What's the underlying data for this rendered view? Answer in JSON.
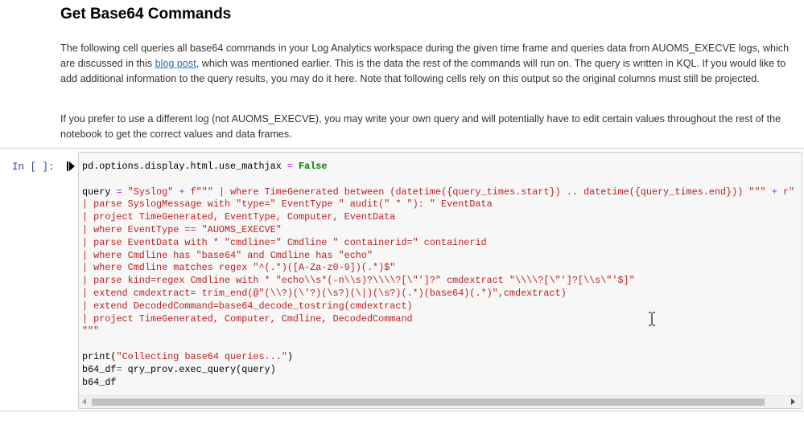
{
  "markdown": {
    "heading": "Get Base64 Commands",
    "p1_a": "The following cell queries all base64 commands in your Log Analytics workspace during the given time frame and queries data from AUOMS_EXECVE logs, which are discussed in this ",
    "p1_link": "blog post",
    "p1_b": ", which was mentioned earlier. This is the data the rest of the commands will run on. The query is written in KQL. If you would like to add additional information to the query results, you may do it here. Note that following cells rely on this output so the original columns must still be projected.",
    "p2": "If you prefer to use a different log (not AUOMS_EXECVE), you may write your own query and will potentially have to edit certain values throughout the rest of the notebook to get the correct values and data frames."
  },
  "cell": {
    "prompt": "In [ ]:",
    "lines": [
      [
        {
          "t": "pd.options.display.html.use_mathjax ",
          "c": ""
        },
        {
          "t": "=",
          "c": "op"
        },
        {
          "t": " ",
          "c": ""
        },
        {
          "t": "False",
          "c": "kw"
        }
      ],
      [],
      [
        {
          "t": "query ",
          "c": ""
        },
        {
          "t": "=",
          "c": "op"
        },
        {
          "t": " ",
          "c": ""
        },
        {
          "t": "\"Syslog\"",
          "c": "str"
        },
        {
          "t": " ",
          "c": ""
        },
        {
          "t": "+",
          "c": "op"
        },
        {
          "t": " ",
          "c": ""
        },
        {
          "t": "f\"\"\" | where TimeGenerated between (datetime({query_times.start}) .. datetime({query_times.end})) \"\"\"",
          "c": "str"
        },
        {
          "t": " ",
          "c": ""
        },
        {
          "t": "+",
          "c": "op"
        },
        {
          "t": " ",
          "c": ""
        },
        {
          "t": "r\"",
          "c": "str"
        }
      ],
      [
        {
          "t": "| parse SyslogMessage with \"type=\" EventType \" audit(\" * \"): \" EventData",
          "c": "str"
        }
      ],
      [
        {
          "t": "| project TimeGenerated, EventType, Computer, EventData",
          "c": "str"
        }
      ],
      [
        {
          "t": "| where EventType == \"AUOMS_EXECVE\"",
          "c": "str"
        }
      ],
      [
        {
          "t": "| parse EventData with * \"cmdline=\" Cmdline \" containerid=\" containerid",
          "c": "str"
        }
      ],
      [
        {
          "t": "| where Cmdline has \"base64\" and Cmdline has \"echo\"",
          "c": "str"
        }
      ],
      [
        {
          "t": "| where Cmdline matches regex \"^(.*)([A-Za-z0-9])(.*)$\"",
          "c": "str"
        }
      ],
      [
        {
          "t": "| parse kind=regex Cmdline with * \"echo\\\\s*(-n\\\\s)?\\\\\\\\?[\\\"']?\" cmdextract \"\\\\\\\\?[\\\"']?[\\\\s\\\"'$]\"",
          "c": "str"
        }
      ],
      [
        {
          "t": "| extend cmdextract= trim_end(@\"(\\\\?)(\\'?)(\\s?)(\\|)(\\s?)(.*)(base64)(.*)\",cmdextract)",
          "c": "str"
        }
      ],
      [
        {
          "t": "| extend DecodedCommand=base64_decode_tostring(cmdextract)",
          "c": "str"
        }
      ],
      [
        {
          "t": "| project TimeGenerated, Computer, Cmdline, DecodedCommand",
          "c": "str"
        }
      ],
      [
        {
          "t": "\"\"\"",
          "c": "str"
        }
      ],
      [],
      [
        {
          "t": "print",
          "c": ""
        },
        {
          "t": "(",
          "c": ""
        },
        {
          "t": "\"Collecting base64 queries...\"",
          "c": "str"
        },
        {
          "t": ")",
          "c": ""
        }
      ],
      [
        {
          "t": "b64_df",
          "c": ""
        },
        {
          "t": "=",
          "c": "op"
        },
        {
          "t": " qry_prov.exec_query(query)",
          "c": ""
        }
      ],
      [
        {
          "t": "b64_df",
          "c": ""
        }
      ]
    ]
  },
  "icons": {
    "run": "run-cell-icon",
    "cursor": "text-cursor-icon",
    "scroll_left": "scroll-left-icon",
    "scroll_right": "scroll-right-icon"
  },
  "colors": {
    "string": "#ba2121",
    "keyword": "#008000",
    "operator": "#aa22ff",
    "prompt": "#303f9f",
    "link": "#296eaa"
  }
}
